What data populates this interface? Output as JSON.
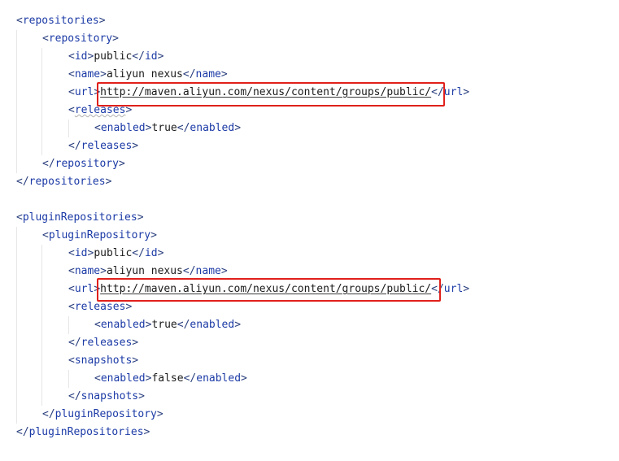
{
  "colors": {
    "tag": "#1b3aa6",
    "bracket": "#2a3f7e",
    "text": "#1a1a1a",
    "highlight_border": "#e0201b",
    "indent_guide": "#e6e6e6",
    "background": "#ffffff"
  },
  "code": {
    "l1": {
      "tag": "repositories"
    },
    "l2": {
      "tag": "repository"
    },
    "l3": {
      "tag": "id",
      "value": "public"
    },
    "l4": {
      "tag": "name",
      "value": "aliyun nexus"
    },
    "l5": {
      "tag": "url",
      "value": "http://maven.aliyun.com/nexus/content/groups/public/"
    },
    "l6": {
      "tag": "releases"
    },
    "l7": {
      "tag": "enabled",
      "value": "true"
    },
    "l8": {
      "tag": "releases"
    },
    "l9": {
      "tag": "repository"
    },
    "l10": {
      "tag": "repositories"
    },
    "l11": {
      "tag": "pluginRepositories"
    },
    "l12": {
      "tag": "pluginRepository"
    },
    "l13": {
      "tag": "id",
      "value": "public"
    },
    "l14": {
      "tag": "name",
      "value": "aliyun nexus"
    },
    "l15": {
      "tag": "url",
      "value": "http://maven.aliyun.com/nexus/content/groups/public/"
    },
    "l16": {
      "tag": "releases"
    },
    "l17": {
      "tag": "enabled",
      "value": "true"
    },
    "l18": {
      "tag": "releases"
    },
    "l19": {
      "tag": "snapshots"
    },
    "l20": {
      "tag": "enabled",
      "value": "false"
    },
    "l21": {
      "tag": "snapshots"
    },
    "l22": {
      "tag": "pluginRepository"
    },
    "l23": {
      "tag": "pluginRepositories"
    }
  }
}
